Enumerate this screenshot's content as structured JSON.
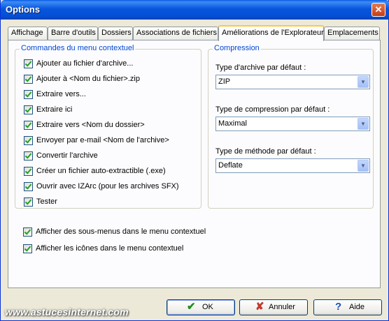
{
  "window": {
    "title": "Options",
    "close_glyph": "✕"
  },
  "tabs": [
    {
      "label": "Affichage"
    },
    {
      "label": "Barre d'outils"
    },
    {
      "label": "Dossiers"
    },
    {
      "label": "Associations de fichiers"
    },
    {
      "label": "Améliorations de l'Explorateur",
      "active": true
    },
    {
      "label": "Emplacements"
    }
  ],
  "context_menu_group": {
    "title": "Commandes du menu contextuel",
    "items": [
      {
        "label": "Ajouter au fichier d'archive...",
        "checked": true
      },
      {
        "label": "Ajouter à <Nom du fichier>.zip",
        "checked": true
      },
      {
        "label": "Extraire vers...",
        "checked": true
      },
      {
        "label": "Extraire ici",
        "checked": true
      },
      {
        "label": "Extraire vers <Nom du dossier>",
        "checked": true
      },
      {
        "label": "Envoyer par e-mail <Nom de l'archive>",
        "checked": true
      },
      {
        "label": "Convertir l'archive",
        "checked": true
      },
      {
        "label": "Créer un fichier auto-extractible (.exe)",
        "checked": true
      },
      {
        "label": "Ouvrir avec IZArc (pour les archives SFX)",
        "checked": true
      },
      {
        "label": "Tester",
        "checked": true
      }
    ]
  },
  "compression_group": {
    "title": "Compression",
    "archive_type": {
      "label": "Type d'archive par défaut :",
      "value": "ZIP"
    },
    "compression_type": {
      "label": "Type de compression par défaut :",
      "value": "Maximal"
    },
    "method_type": {
      "label": "Type de méthode par défaut :",
      "value": "Deflate"
    }
  },
  "options": [
    {
      "label": "Afficher des sous-menus dans le menu contextuel",
      "checked": true
    },
    {
      "label": "Afficher les icônes dans le menu contextuel",
      "checked": true
    }
  ],
  "buttons": {
    "ok": {
      "label": "OK",
      "icon": "check-icon",
      "glyph": "✔",
      "color": "#1e8c1e"
    },
    "cancel": {
      "label": "Annuler",
      "icon": "x-icon",
      "glyph": "✘",
      "color": "#c0392b"
    },
    "help": {
      "label": "Aide",
      "icon": "question-icon",
      "glyph": "?",
      "color": "#1b4fb8"
    }
  },
  "watermark": "www.astucesinternet.com"
}
